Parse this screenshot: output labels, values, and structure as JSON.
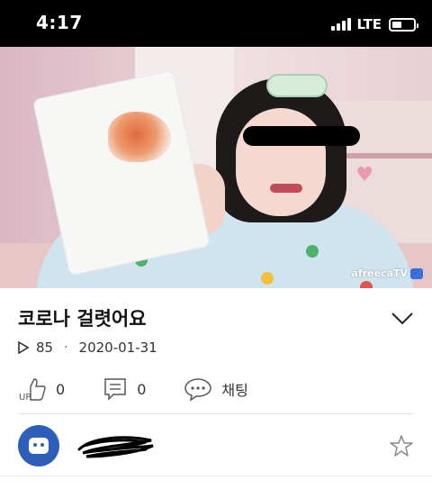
{
  "status_bar": {
    "time": "4:17",
    "network": "LTE",
    "battery_level": 0.45
  },
  "video": {
    "watermark": "afreecaTV"
  },
  "post": {
    "title": "코로나 걸렷어요",
    "views": "85",
    "separator": "·",
    "date": "2020-01-31"
  },
  "actions": {
    "up_count": "0",
    "up_label": "UP",
    "comment_count": "0",
    "chat_label": "채팅"
  },
  "colors": {
    "accent_blue": "#2e5fb8",
    "status_bar": "#000000",
    "text": "#111111"
  }
}
